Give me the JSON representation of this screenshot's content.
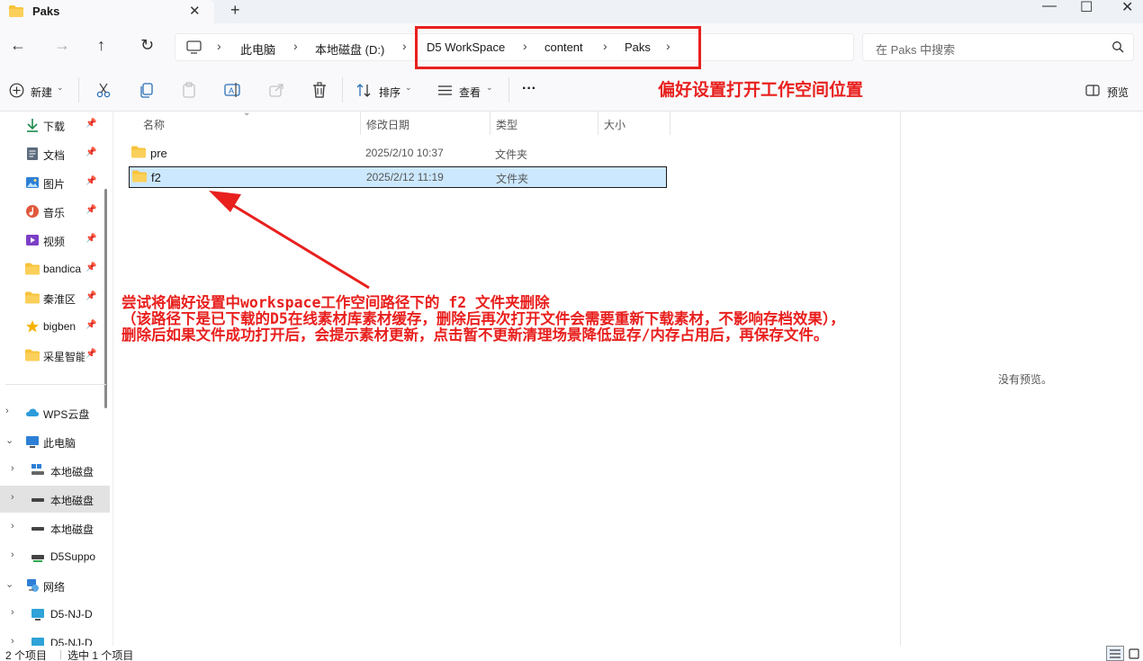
{
  "window": {
    "tab_title": "Paks",
    "tab_close": "✕",
    "tab_add": "+",
    "minimize": "—",
    "maximize": "☐",
    "close": "✕"
  },
  "nav": {
    "back": "←",
    "forward": "→",
    "up": "↑",
    "refresh": "↻"
  },
  "breadcrumb": {
    "items": [
      "此电脑",
      "本地磁盘 (D:)",
      "D5 WorkSpace",
      "content",
      "Paks"
    ],
    "separator": "›"
  },
  "search": {
    "placeholder": "在 Paks 中搜索"
  },
  "toolbar": {
    "new_label": "新建",
    "sort_label": "排序",
    "view_label": "查看",
    "more_label": "···",
    "preview_label": "预览"
  },
  "sidebar": {
    "quick": [
      {
        "label": "下载",
        "icon": "download-icon"
      },
      {
        "label": "文档",
        "icon": "document-icon"
      },
      {
        "label": "图片",
        "icon": "picture-icon"
      },
      {
        "label": "音乐",
        "icon": "music-icon"
      },
      {
        "label": "视频",
        "icon": "video-icon"
      },
      {
        "label": "bandica",
        "icon": "folder-icon"
      },
      {
        "label": "秦淮区",
        "icon": "folder-icon"
      },
      {
        "label": "bigben",
        "icon": "star-icon"
      },
      {
        "label": "采星智能",
        "icon": "folder-icon"
      }
    ],
    "tree": [
      {
        "label": "WPS云盘",
        "icon": "cloud-icon",
        "expanded": false
      },
      {
        "label": "此电脑",
        "icon": "computer-icon",
        "expanded": true
      },
      {
        "label": "本地磁盘",
        "icon": "drive-icon",
        "expanded": false
      },
      {
        "label": "本地磁盘",
        "icon": "drive-icon",
        "expanded": false,
        "selected": true
      },
      {
        "label": "本地磁盘",
        "icon": "drive-icon",
        "expanded": false
      },
      {
        "label": "D5Suppo",
        "icon": "drive-icon",
        "expanded": false
      },
      {
        "label": "网络",
        "icon": "network-icon",
        "expanded": true
      },
      {
        "label": "D5-NJ-D",
        "icon": "monitor-icon",
        "expanded": false
      },
      {
        "label": "D5-NJ-D",
        "icon": "monitor-icon",
        "expanded": false
      }
    ]
  },
  "columns": {
    "name": "名称",
    "modified": "修改日期",
    "type": "类型",
    "size": "大小"
  },
  "files": [
    {
      "name": "pre",
      "modified": "2025/2/10 10:37",
      "type": "文件夹",
      "selected": false
    },
    {
      "name": "f2",
      "modified": "2025/2/12 11:19",
      "type": "文件夹",
      "selected": true
    }
  ],
  "preview": {
    "empty_text": "没有预览。"
  },
  "status": {
    "count": "2 个项目",
    "selected": "选中 1 个项目"
  },
  "annotations": {
    "title": "偏好设置打开工作空间位置",
    "note_lines": [
      "尝试将偏好设置中workspace工作空间路径下的 f2 文件夹删除",
      "（该路径下是已下载的D5在线素材库素材缓存，删除后再次打开文件会需要重新下载素材，不影响存档效果），",
      "删除后如果文件成功打开后，会提示素材更新，点击暂不更新清理场景降低显存/内存占用后，再保存文件。"
    ],
    "color": "#e8201e"
  },
  "colors": {
    "accent": "#0067c0",
    "selection": "#cce8ff",
    "folder": "#f8c33a",
    "annotation": "#e8201e"
  }
}
